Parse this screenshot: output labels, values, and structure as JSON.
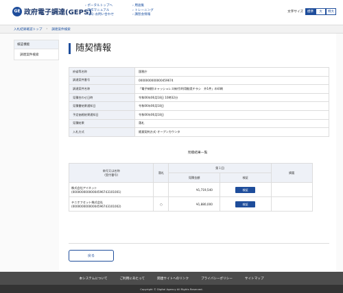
{
  "header": {
    "logo_mark": "GE",
    "site_title": "政府電子調達(GEPS)",
    "nav_left": [
      "ポータルトップへ",
      "操作マニュアル",
      "FAQ･お問い合わせ"
    ],
    "nav_right": [
      "用語集",
      "トレーニング",
      "講習会情報"
    ],
    "font_size_label": "文字サイズ",
    "font_sizes": [
      "標準",
      "大",
      "特大"
    ],
    "font_size_active": "標準"
  },
  "breadcrumb": [
    "入札結果確認トップ",
    "調達案件検索"
  ],
  "sidebar": {
    "heading": "検証機能",
    "items": [
      "調達案件検索"
    ]
  },
  "main": {
    "page_title": "随契情報",
    "info_rows": [
      {
        "label": "府省等名称",
        "value": "国税庁"
      },
      {
        "label": "調達案件番号",
        "value": "0000000000000459674"
      },
      {
        "label": "調達案件名称",
        "value": "「電子納税(キャッシュレス納付)利用勧奨チラシ　外1件」の印刷"
      },
      {
        "label": "見積合わせ日時",
        "value": "令和06年06月18日 10時32分"
      },
      {
        "label": "見積書結果通知日",
        "value": "令和06年06月18日"
      },
      {
        "label": "予定価格結果通知日",
        "value": "令和06年06月18日"
      },
      {
        "label": "見積結果",
        "value": "落札"
      },
      {
        "label": "入札方式",
        "value": "随意契約方式･オープンカウンタ"
      }
    ],
    "results_title": "見積結果一覧",
    "results_headers": {
      "name": "商号又は名称",
      "name_sub": "(受付番号)",
      "award": "落札",
      "round1": "第１回",
      "amount": "見積金額",
      "verify": "検証",
      "remarks": "摘要"
    },
    "results_rows": [
      {
        "name": "株式会社アイネット",
        "receipt": "(0000000000000459674310100​1)",
        "award": "",
        "amount": "¥1,719,540",
        "verify": "検証",
        "remarks": ""
      },
      {
        "name": "テニオフセット株式会社",
        "receipt": "(00000000000004596743101002)",
        "award": "○",
        "amount": "¥1,880,000",
        "verify": "検証",
        "remarks": ""
      }
    ],
    "back_label": "戻る"
  },
  "footer": {
    "links": [
      "本システムについて",
      "ご利用にあたって",
      "関連サイトへのリンク",
      "プライバシーポリシー",
      "サイトマップ"
    ],
    "copyright": "Copyright © Digital Agency All Rights Reserved."
  }
}
